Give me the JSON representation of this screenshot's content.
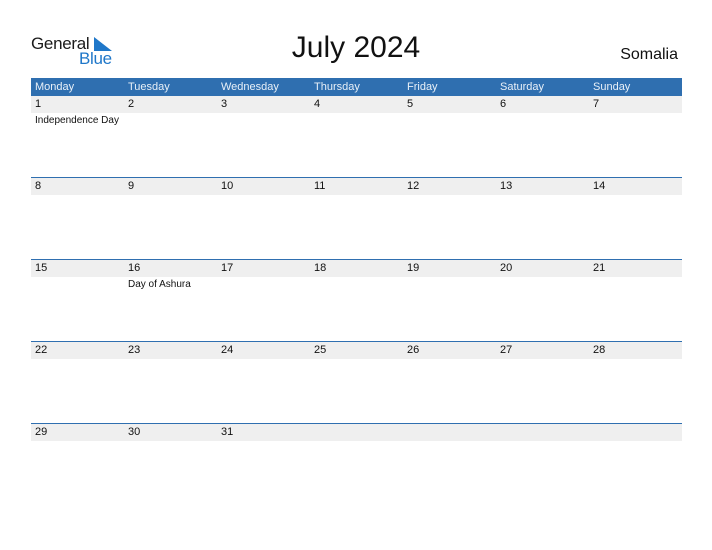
{
  "logo": {
    "line1": "General",
    "line2": "Blue"
  },
  "title": "July 2024",
  "country": "Somalia",
  "colors": {
    "header_bg": "#2f6fb0",
    "day_strip_bg": "#efefef",
    "brand_blue": "#1f77c9"
  },
  "weekdays": [
    "Monday",
    "Tuesday",
    "Wednesday",
    "Thursday",
    "Friday",
    "Saturday",
    "Sunday"
  ],
  "weeks": [
    {
      "days": [
        "1",
        "2",
        "3",
        "4",
        "5",
        "6",
        "7"
      ],
      "events": [
        "Independence Day",
        "",
        "",
        "",
        "",
        "",
        ""
      ]
    },
    {
      "days": [
        "8",
        "9",
        "10",
        "11",
        "12",
        "13",
        "14"
      ],
      "events": [
        "",
        "",
        "",
        "",
        "",
        "",
        ""
      ]
    },
    {
      "days": [
        "15",
        "16",
        "17",
        "18",
        "19",
        "20",
        "21"
      ],
      "events": [
        "",
        "Day of Ashura",
        "",
        "",
        "",
        "",
        ""
      ]
    },
    {
      "days": [
        "22",
        "23",
        "24",
        "25",
        "26",
        "27",
        "28"
      ],
      "events": [
        "",
        "",
        "",
        "",
        "",
        "",
        ""
      ]
    },
    {
      "days": [
        "29",
        "30",
        "31",
        "",
        "",
        "",
        ""
      ],
      "events": [
        "",
        "",
        "",
        "",
        "",
        "",
        ""
      ]
    }
  ]
}
